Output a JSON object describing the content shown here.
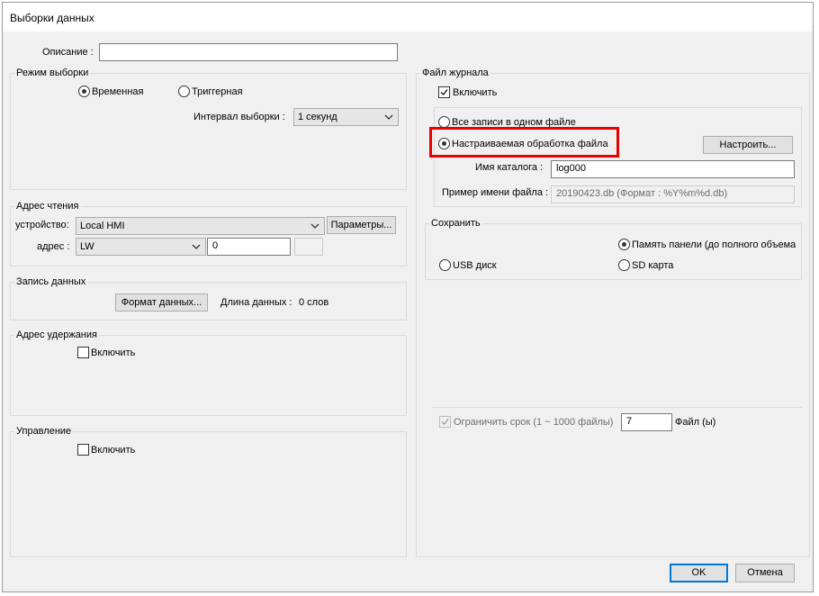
{
  "window": {
    "title": "Выборки данных"
  },
  "description": {
    "label": "Описание :",
    "value": ""
  },
  "sampling_mode": {
    "group_title": "Режим выборки",
    "option_timed": "Временная",
    "option_trigger": "Триггерная",
    "interval_label": "Интервал выборки :",
    "interval_value": "1 секунд"
  },
  "read_address": {
    "group_title": "Адрес чтения",
    "device_label": "устройство:",
    "device_value": "Local HMI",
    "params_button": "Параметры...",
    "address_label": "адрес :",
    "address_type": "LW",
    "address_value": "0"
  },
  "data_record": {
    "group_title": "Запись данных",
    "format_button": "Формат данных...",
    "length_label": "Длина данных :",
    "length_value": "0 слов"
  },
  "hold_address": {
    "group_title": "Адрес удержания",
    "enable_label": "Включить"
  },
  "control": {
    "group_title": "Управление",
    "enable_label": "Включить"
  },
  "log_file": {
    "group_title": "Файл журнала",
    "enable_label": "Включить",
    "option_single_file": "Все записи в одном файле",
    "option_custom": "Настраиваемая обработка файла",
    "configure_button": "Настроить...",
    "folder_label": "Имя каталога :",
    "folder_value": "log000",
    "example_label": "Пример имени файла :",
    "example_value": "20190423.db (Формат : %Y%m%d.db)"
  },
  "save": {
    "group_title": "Сохранить",
    "option_panel_memory": "Память панели (до полного объема)",
    "option_usb": "USB диск",
    "option_sd": "SD карта"
  },
  "limit": {
    "label": "Ограничить срок (1 ~ 1000 файлы)",
    "value": "7",
    "unit": "Файл (ы)"
  },
  "footer": {
    "ok": "OK",
    "cancel": "Отмена"
  },
  "colors": {
    "highlight": "#e60000",
    "accent": "#0078d7"
  }
}
